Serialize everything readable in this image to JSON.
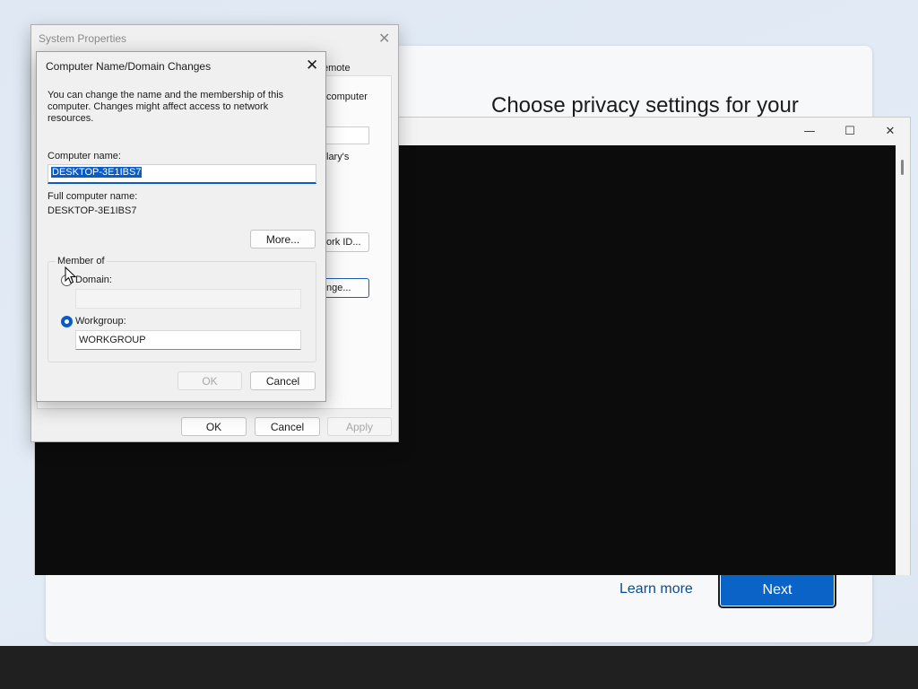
{
  "oobe": {
    "heading": "Choose privacy settings for your",
    "learn_more": "Learn more",
    "next": "Next"
  },
  "console": {
    "controls": {
      "minimize": "—",
      "maximize": "☐",
      "close": "✕"
    }
  },
  "system_properties": {
    "title": "System Properties",
    "close": "✕",
    "tab_fragment": "emote",
    "fragments": {
      "computer": "computer",
      "arys": "lary's",
      "network_id": "ork ID...",
      "change": "nge..."
    },
    "buttons": {
      "ok": "OK",
      "cancel": "Cancel",
      "apply": "Apply"
    }
  },
  "name_changes": {
    "title": "Computer Name/Domain Changes",
    "close": "✕",
    "description": "You can change the name and the membership of this computer. Changes might affect access to network resources.",
    "computer_name_label": "Computer name:",
    "computer_name_value": "DESKTOP-3E1IBS7",
    "full_name_label": "Full computer name:",
    "full_name_value": "DESKTOP-3E1IBS7",
    "more_button": "More...",
    "member_of": {
      "legend": "Member of",
      "domain_label": "Domain:",
      "domain_value": "",
      "domain_selected": false,
      "workgroup_label": "Workgroup:",
      "workgroup_value": "WORKGROUP",
      "workgroup_selected": true
    },
    "buttons": {
      "ok": "OK",
      "cancel": "Cancel"
    }
  },
  "colors": {
    "accent": "#0a5bc4",
    "next_button": "#0a63c7",
    "console_bg": "#0c0c0c",
    "taskbar": "#202020"
  }
}
